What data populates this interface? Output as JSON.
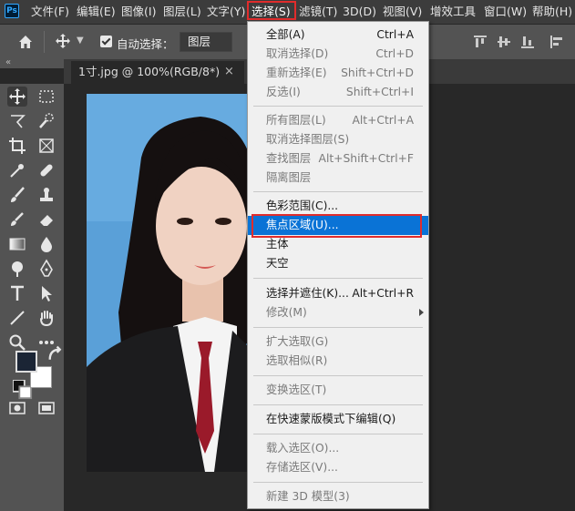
{
  "app": {
    "logo_text": "Ps"
  },
  "menubar": {
    "items": [
      "文件(F)",
      "编辑(E)",
      "图像(I)",
      "图层(L)",
      "文字(Y)",
      "选择(S)",
      "滤镜(T)",
      "3D(D)",
      "视图(V)",
      "增效工具",
      "窗口(W)",
      "帮助(H)"
    ],
    "active_index": 5
  },
  "options_bar": {
    "auto_select_label": "自动选择：",
    "auto_select_checked": true,
    "layer_select_value": "图层"
  },
  "document": {
    "tab_title": "1寸.jpg @ 100%(RGB/8*)",
    "close_symbol": "×"
  },
  "colors": {
    "foreground": "#1b2535",
    "background": "#ffffff",
    "highlight": "#0a73d6",
    "annotation": "#e02c2c"
  },
  "select_menu": {
    "items": [
      {
        "label": "全部(A)",
        "shortcut": "Ctrl+A",
        "enabled": true
      },
      {
        "label": "取消选择(D)",
        "shortcut": "Ctrl+D",
        "enabled": false
      },
      {
        "label": "重新选择(E)",
        "shortcut": "Shift+Ctrl+D",
        "enabled": false
      },
      {
        "label": "反选(I)",
        "shortcut": "Shift+Ctrl+I",
        "enabled": false
      },
      {
        "label": "所有图层(L)",
        "shortcut": "Alt+Ctrl+A",
        "enabled": false
      },
      {
        "label": "取消选择图层(S)",
        "shortcut": "",
        "enabled": false
      },
      {
        "label": "查找图层",
        "shortcut": "Alt+Shift+Ctrl+F",
        "enabled": false
      },
      {
        "label": "隔离图层",
        "shortcut": "",
        "enabled": false
      },
      {
        "label": "色彩范围(C)...",
        "shortcut": "",
        "enabled": true
      },
      {
        "label": "焦点区域(U)...",
        "shortcut": "",
        "enabled": true,
        "highlighted": true
      },
      {
        "label": "主体",
        "shortcut": "",
        "enabled": true
      },
      {
        "label": "天空",
        "shortcut": "",
        "enabled": true
      },
      {
        "label": "选择并遮住(K)...",
        "shortcut": "Alt+Ctrl+R",
        "enabled": true
      },
      {
        "label": "修改(M)",
        "shortcut": "",
        "enabled": false,
        "submenu": true
      },
      {
        "label": "扩大选取(G)",
        "shortcut": "",
        "enabled": false
      },
      {
        "label": "选取相似(R)",
        "shortcut": "",
        "enabled": false
      },
      {
        "label": "变换选区(T)",
        "shortcut": "",
        "enabled": false
      },
      {
        "label": "在快速蒙版模式下编辑(Q)",
        "shortcut": "",
        "enabled": true
      },
      {
        "label": "载入选区(O)...",
        "shortcut": "",
        "enabled": false
      },
      {
        "label": "存储选区(V)...",
        "shortcut": "",
        "enabled": false
      },
      {
        "label": "新建 3D 模型(3)",
        "shortcut": "",
        "enabled": false
      }
    ]
  }
}
